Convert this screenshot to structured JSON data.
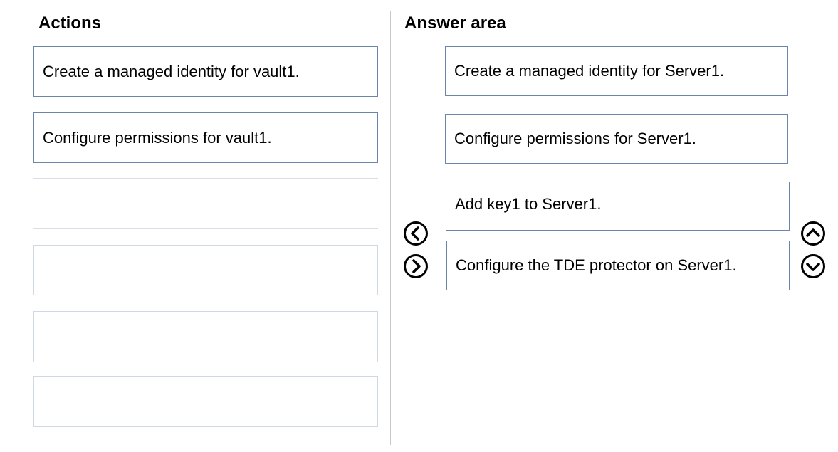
{
  "actions": {
    "heading": "Actions",
    "items": [
      {
        "label": "Create a managed identity for vault1."
      },
      {
        "label": "Configure permissions for vault1."
      },
      {
        "label": ""
      },
      {
        "label": ""
      },
      {
        "label": ""
      },
      {
        "label": ""
      }
    ]
  },
  "answer_area": {
    "heading": "Answer area",
    "items": [
      {
        "label": "Create a managed identity for Server1."
      },
      {
        "label": "Configure permissions for Server1."
      },
      {
        "label": "Add key1 to Server1."
      },
      {
        "label": "Configure the TDE protector on Server1."
      }
    ]
  },
  "controls": {
    "move_left_icon": "chevron-left-circle-icon",
    "move_right_icon": "chevron-right-circle-icon",
    "move_up_icon": "chevron-up-circle-icon",
    "move_down_icon": "chevron-down-circle-icon"
  },
  "colors": {
    "box_border": "#6b86a8",
    "empty_border": "#d9dfe6",
    "divider": "#c8c8c8",
    "icon": "#000000"
  }
}
